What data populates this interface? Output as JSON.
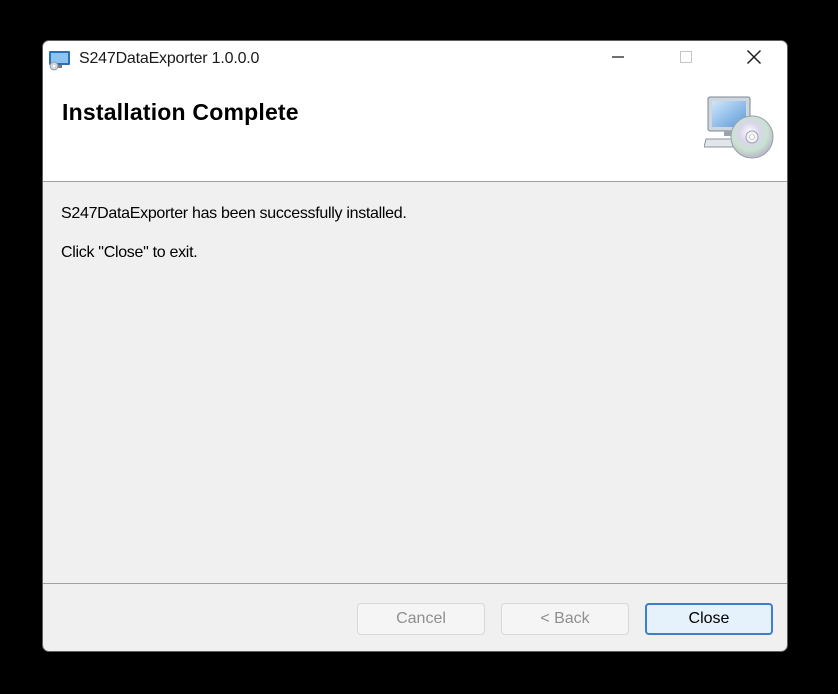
{
  "window": {
    "title": "S247DataExporter 1.0.0.0"
  },
  "caption_buttons": {
    "minimize": "minimize-icon",
    "maximize": "maximize-icon",
    "close": "close-icon"
  },
  "header": {
    "title": "Installation Complete",
    "icon": "computer-cd-icon"
  },
  "body": {
    "message": "S247DataExporter has been successfully installed.",
    "instruction": "Click \"Close\" to exit."
  },
  "buttons": {
    "cancel_label": "Cancel",
    "back_label": "< Back",
    "close_label": "Close",
    "cancel_enabled": false,
    "back_enabled": false,
    "close_enabled": true
  },
  "colors": {
    "primary_button_border": "#3c7fcd",
    "primary_button_fill": "#e5f1fb",
    "dialog_background": "#f0f0f0"
  }
}
